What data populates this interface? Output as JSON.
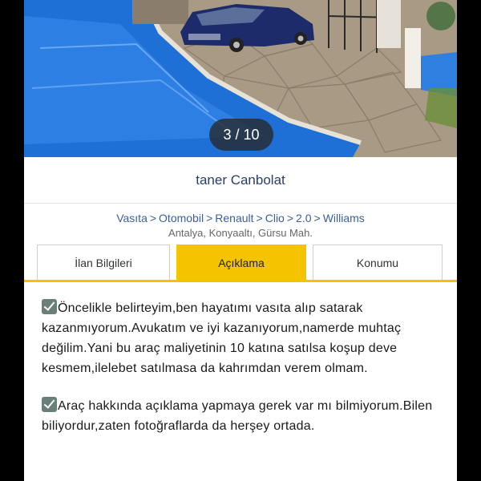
{
  "photo": {
    "counter": "3 / 10"
  },
  "seller": {
    "name": "taner Canbolat"
  },
  "breadcrumb": {
    "items": [
      "Vasıta",
      "Otomobil",
      "Renault",
      "Clio",
      "2.0",
      "Williams"
    ],
    "separator": ">"
  },
  "location": "Antalya, Konyaaltı, Gürsu Mah.",
  "tabs": [
    {
      "label": "İlan Bilgileri",
      "active": false
    },
    {
      "label": "Açıklama",
      "active": true
    },
    {
      "label": "Konumu",
      "active": false
    }
  ],
  "description": {
    "paragraphs": [
      "Öncelikle belirteyim,ben hayatımı vasıta alıp satarak kazanmıyorum.Avukatım ve iyi kazanıyorum,namerde muhtaç değilim.Yani bu araç maliyetinin 10 katına satılsa koşup deve kesmem,ilelebet satılmasa da kahrımdan verem olmam.",
      "Araç hakkında açıklama yapmaya gerek var mı bilmiyorum.Bilen biliyordur,zaten fotoğraflarda da herşey ortada."
    ]
  },
  "colors": {
    "accent_tab": "#f5c400",
    "link_blue": "#3a5f9a",
    "seller_text": "#2a3f66"
  }
}
